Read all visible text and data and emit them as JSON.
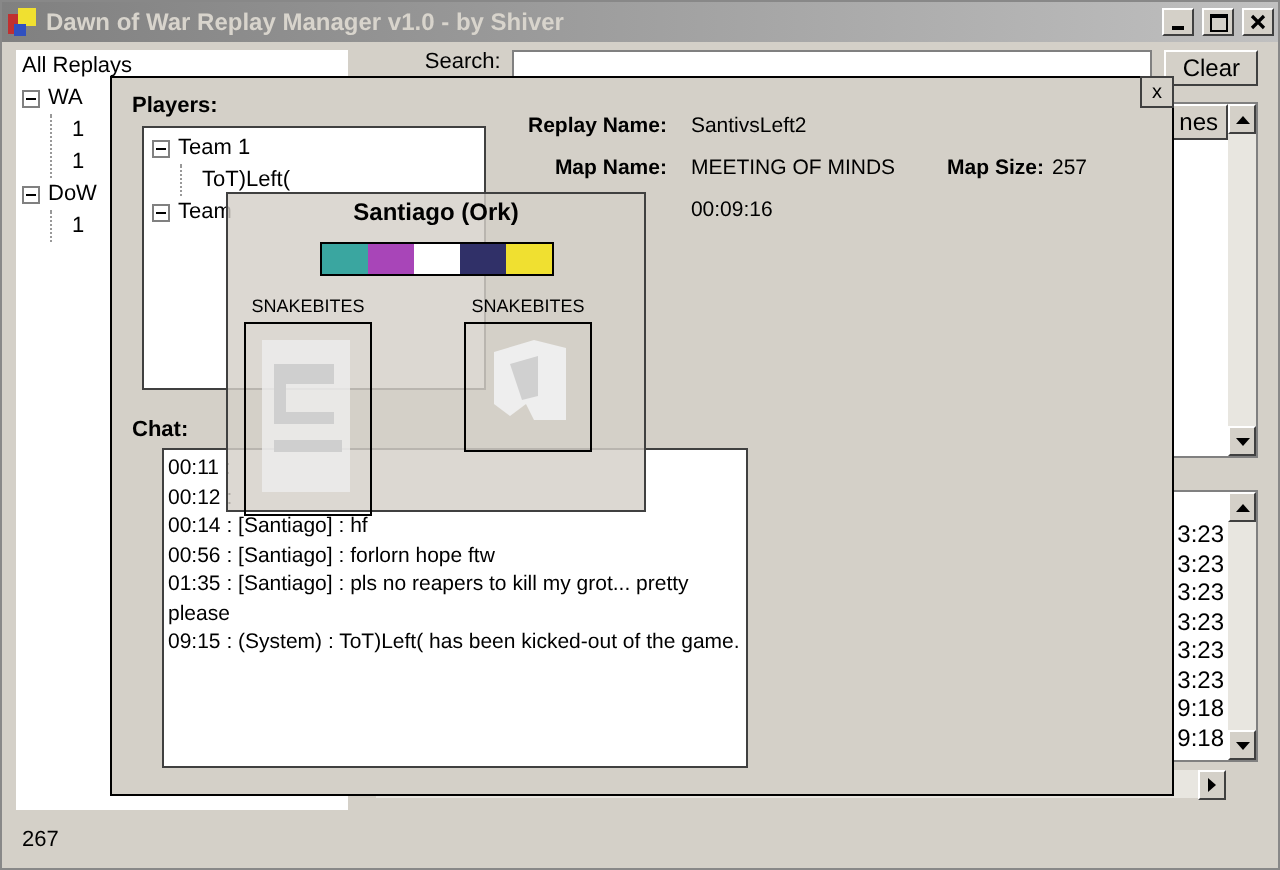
{
  "window": {
    "title": "Dawn of War Replay Manager v1.0 - by Shiver"
  },
  "replay_tree": {
    "root": "All Replays",
    "children": [
      {
        "label": "WA",
        "expanded": true,
        "children": [
          {
            "label": "1"
          },
          {
            "label": "1"
          }
        ]
      },
      {
        "label": "DoW",
        "expanded": true,
        "children": [
          {
            "label": "1"
          }
        ]
      }
    ]
  },
  "search": {
    "label": "Search:",
    "clear_button": "Clear"
  },
  "replay_list": {
    "columns": [
      "nes"
    ]
  },
  "details_list": {
    "rows": [
      "3:23",
      "3:23",
      "3:23",
      "3:23",
      "3:23",
      "3:23",
      "9:18",
      "9:18"
    ]
  },
  "status_bar": {
    "text": "267"
  },
  "replay_dialog": {
    "close": "x",
    "players_label": "Players:",
    "players": [
      {
        "label": "Team 1",
        "expanded": true,
        "children": [
          {
            "label": "ToT)Left("
          }
        ]
      },
      {
        "label": "Team",
        "expanded": true
      }
    ],
    "fields": [
      {
        "label": "Replay Name:",
        "value": "SantivsLeft2"
      },
      {
        "label": "Map Name:",
        "value": "MEETING  OF  MINDS",
        "extra_label": "Map Size:",
        "extra_value": "257"
      },
      {
        "value": "00:09:16"
      }
    ],
    "chat_label": "Chat:",
    "chat": [
      "00:11 :",
      "00:12 :",
      "00:14 : [Santiago] : hf",
      "00:56 : [Santiago] : forlorn hope ftw",
      "01:35 : [Santiago] : pls no reapers to kill my grot... pretty please",
      "09:15 : (System) : ToT)Left( has been kicked-out of the game."
    ]
  },
  "player_popup": {
    "title": "Santiago (Ork)",
    "colors": [
      {
        "color": "#3aa6a0"
      },
      {
        "color": "#a845b8"
      },
      {
        "color": "#ffffff"
      },
      {
        "color": "#303068"
      },
      {
        "color": "#f0e030"
      }
    ],
    "emblems": [
      {
        "label": "SNAKEBITES",
        "kind": "banner"
      },
      {
        "label": "SNAKEBITES",
        "kind": "badge"
      }
    ]
  }
}
